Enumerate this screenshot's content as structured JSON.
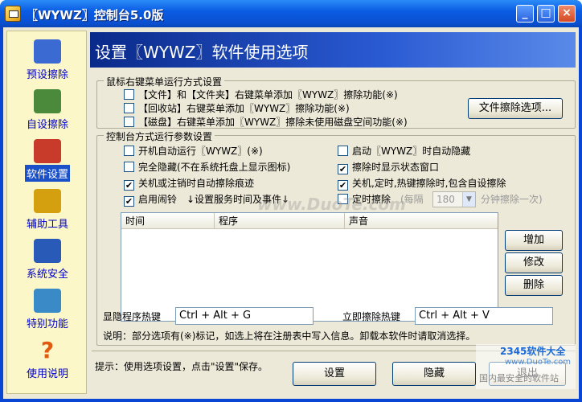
{
  "window": {
    "title": "〖WYWZ〗控制台5.0版",
    "minimize_glyph": "_",
    "maximize_glyph": "□",
    "close_glyph": "×"
  },
  "sidebar": {
    "items": [
      {
        "label": "预设擦除",
        "icon": "preset-erase-icon",
        "color": "#3a6ad2"
      },
      {
        "label": "自设擦除",
        "icon": "custom-erase-icon",
        "color": "#4a8a3a"
      },
      {
        "label": "软件设置",
        "icon": "software-settings-icon",
        "color": "#c83a2a",
        "active": true
      },
      {
        "label": "辅助工具",
        "icon": "aux-tools-icon",
        "color": "#d4a010"
      },
      {
        "label": "系统安全",
        "icon": "system-security-icon",
        "color": "#2a5ab8"
      },
      {
        "label": "特别功能",
        "icon": "special-functions-icon",
        "color": "#3a8ac8"
      },
      {
        "label": "使用说明",
        "icon": "help-icon",
        "color": "#e05a10",
        "glyph": "?"
      }
    ]
  },
  "header": {
    "title": "设置〖WYWZ〗软件使用选项"
  },
  "context_menu_group": {
    "title": "鼠标右键菜单运行方式设置",
    "options": [
      {
        "label": "【文件】和【文件夹】右键菜单添加〖WYWZ〗擦除功能(※)",
        "checked": false
      },
      {
        "label": "【回收站】右键菜单添加〖WYWZ〗擦除功能(※)",
        "checked": false
      },
      {
        "label": "【磁盘】右键菜单添加〖WYWZ〗擦除未使用磁盘空间功能(※)",
        "checked": false
      }
    ],
    "file_erase_options_button": "文件擦除选项..."
  },
  "console_group": {
    "title": "控制台方式运行参数设置",
    "left_options": [
      {
        "label": "开机自动运行〖WYWZ〗(※)",
        "checked": false
      },
      {
        "label": "完全隐藏(不在系统托盘上显示图标)",
        "checked": false
      },
      {
        "label": "关机或注销时自动擦除痕迹",
        "checked": true
      },
      {
        "label": "启用闹铃",
        "checked": true
      }
    ],
    "alarm_hint": "↓设置服务时间及事件↓",
    "right_options": [
      {
        "label": "启动〖WYWZ〗时自动隐藏",
        "checked": false
      },
      {
        "label": "擦除时显示状态窗口",
        "checked": true
      },
      {
        "label": "关机,定时,热键擦除时,包含自设擦除",
        "checked": true
      },
      {
        "label": "定时擦除",
        "checked": false
      }
    ],
    "timed_prefix": "(每隔",
    "timed_interval_value": "180",
    "timed_suffix": "分钟擦除一次)",
    "table": {
      "columns": [
        "时间",
        "程序",
        "声音"
      ],
      "rows": []
    },
    "buttons": {
      "add": "增加",
      "edit": "修改",
      "delete": "删除"
    },
    "show_hide_hotkey_label": "显隐程序热键",
    "show_hide_hotkey_value": "Ctrl + Alt + G",
    "erase_now_hotkey_label": "立即擦除热键",
    "erase_now_hotkey_value": "Ctrl + Alt + V",
    "note": "说明：部分选项有(※)标记，如选上将在注册表中写入信息。卸载本软件时请取消选择。"
  },
  "footer": {
    "hint": "提示：使用选项设置，点击\"设置\"保存。",
    "settings_button": "设置",
    "hide_button": "隐藏",
    "exit_button": "退出"
  },
  "watermarks": {
    "center": "www.DuoTe.com",
    "corner_brand": "2345软件大全",
    "corner_url": "www.DuoTe.com",
    "corner_tagline": "国内最安全的软件站"
  }
}
